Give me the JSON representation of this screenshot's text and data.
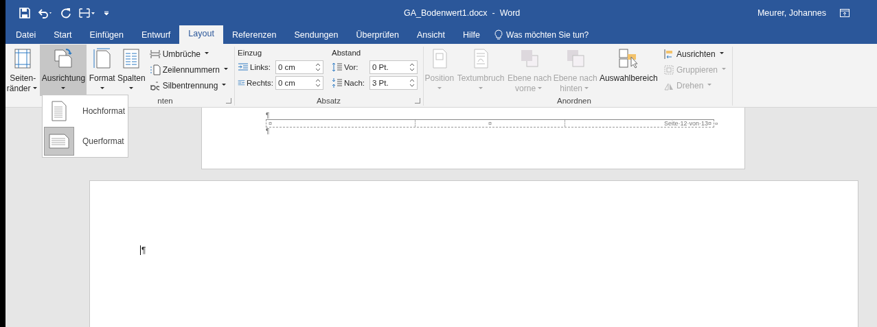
{
  "window": {
    "title": "GA_Bodenwert1.docx  -  Word",
    "user": "Meurer, Johannes"
  },
  "tabs": [
    {
      "label": "Datei",
      "selected": false
    },
    {
      "label": "Start",
      "selected": false
    },
    {
      "label": "Einfügen",
      "selected": false
    },
    {
      "label": "Entwurf",
      "selected": false
    },
    {
      "label": "Layout",
      "selected": true
    },
    {
      "label": "Referenzen",
      "selected": false
    },
    {
      "label": "Sendungen",
      "selected": false
    },
    {
      "label": "Überprüfen",
      "selected": false
    },
    {
      "label": "Ansicht",
      "selected": false
    },
    {
      "label": "Hilfe",
      "selected": false
    }
  ],
  "tell_me": "Was möchten Sie tun?",
  "page_setup": {
    "label": "nten",
    "large": [
      {
        "kind": "margins",
        "lines": [
          "Seiten-",
          "ränder"
        ],
        "selected": false
      },
      {
        "kind": "orientation",
        "lines": [
          "Ausrichtung"
        ],
        "selected": true
      },
      {
        "kind": "size",
        "lines": [
          "Format"
        ],
        "selected": false
      },
      {
        "kind": "columns",
        "lines": [
          "Spalten"
        ],
        "selected": false
      }
    ],
    "small": [
      {
        "kind": "breaks",
        "label": "Umbrüche"
      },
      {
        "kind": "linenumbers",
        "label": "Zeilennummern"
      },
      {
        "kind": "hyphenation",
        "label": "Silbentrennung"
      }
    ]
  },
  "paragraph": {
    "label": "Absatz",
    "columns": [
      {
        "heading": "Einzug",
        "fields": [
          {
            "kind": "left",
            "label": "Links:",
            "value": "0 cm"
          },
          {
            "kind": "right",
            "label": "Rechts:",
            "value": "0 cm"
          }
        ]
      },
      {
        "heading": "Abstand",
        "fields": [
          {
            "kind": "before",
            "label": "Vor:",
            "value": "0 Pt."
          },
          {
            "kind": "after",
            "label": "Nach:",
            "value": "3 Pt."
          }
        ]
      }
    ]
  },
  "arrange": {
    "label": "Anordnen",
    "large": [
      {
        "kind": "position",
        "lines": [
          "Position"
        ],
        "disabled": true
      },
      {
        "kind": "wrap",
        "lines": [
          "Textumbruch"
        ],
        "disabled": true
      },
      {
        "kind": "forward",
        "lines": [
          "Ebene nach",
          "vorne"
        ],
        "disabled": true
      },
      {
        "kind": "backward",
        "lines": [
          "Ebene nach",
          "hinten"
        ],
        "disabled": true
      },
      {
        "kind": "selection",
        "lines": [
          "Auswahlbereich"
        ],
        "disabled": false
      }
    ],
    "small": [
      {
        "kind": "align",
        "label": "Ausrichten",
        "disabled": false
      },
      {
        "kind": "group",
        "label": "Gruppieren",
        "disabled": true
      },
      {
        "kind": "rotate",
        "label": "Drehen",
        "disabled": true
      }
    ]
  },
  "orientation_menu": [
    {
      "kind": "portrait",
      "label": "Hochformat",
      "selected": false
    },
    {
      "kind": "landscape",
      "label": "Querformat",
      "selected": true
    }
  ],
  "document": {
    "footer_mark_top": "¶",
    "footer_cells": [
      "¤",
      "¤",
      "Seite·12·von·13¤"
    ],
    "row_end": "¤",
    "footer_mark_bottom": "¶",
    "body_mark": "¶"
  }
}
